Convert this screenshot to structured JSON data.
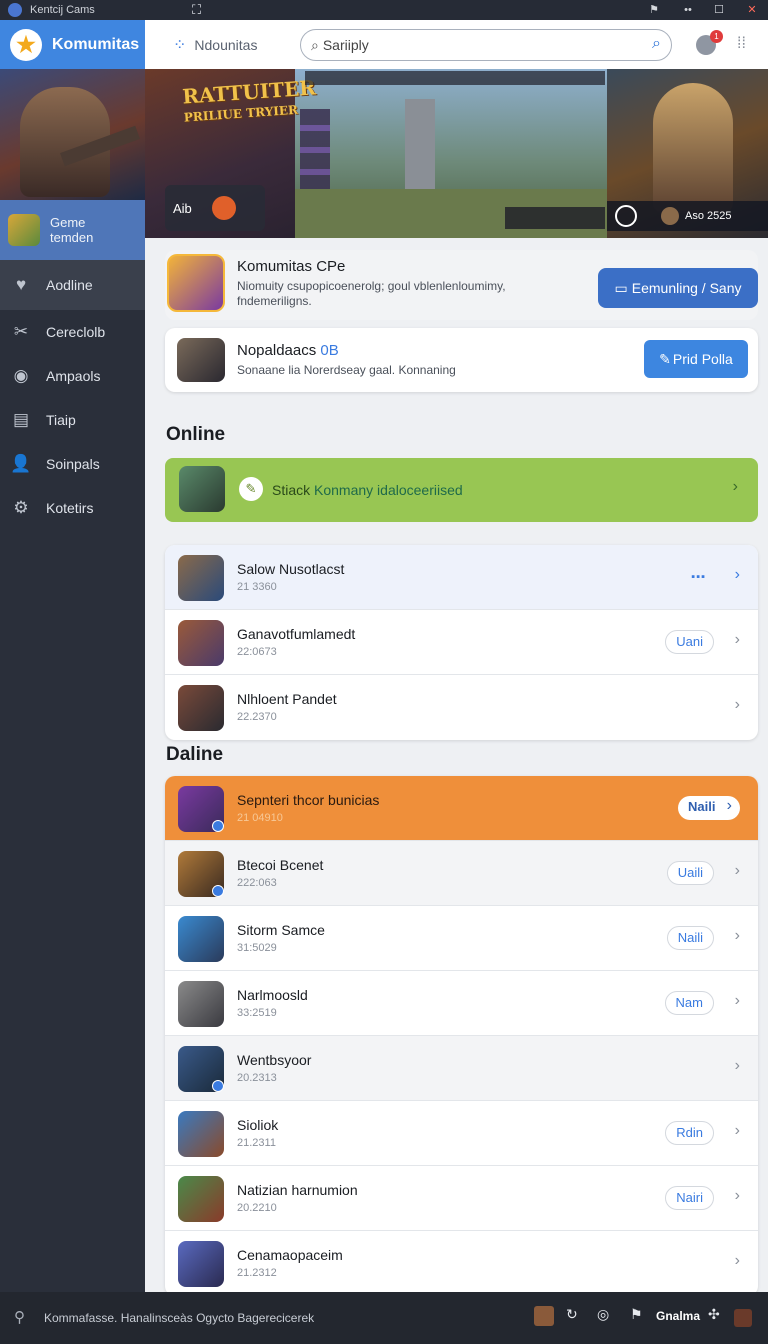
{
  "titlebar": {
    "app_name": "Kentcij Cams",
    "center_icon": "people-icon",
    "controls": [
      "share-icon",
      "more-icon",
      "maximize-icon",
      "close-icon"
    ]
  },
  "sidebar": {
    "brand": "Komumitas",
    "game_item": {
      "line1": "Geme",
      "line2": "temden"
    },
    "items": [
      {
        "label": "Aodline",
        "icon": "heart-icon",
        "active": true
      },
      {
        "label": "Cereclolb",
        "icon": "tools-icon"
      },
      {
        "label": "Ampaols",
        "icon": "target-icon"
      },
      {
        "label": "Tiaip",
        "icon": "list-icon"
      },
      {
        "label": "Soinpals",
        "icon": "person-icon"
      },
      {
        "label": "Kotetirs",
        "icon": "gear-icon"
      }
    ]
  },
  "topbar": {
    "tab_label": "Ndounitas",
    "search_value": "Sariiply",
    "notification_count": "1"
  },
  "banner": {
    "logo_line1": "RATTUITER",
    "logo_line2": "PRILIUE TRYIER",
    "panel_label": "Aib",
    "score_text": "Aso 2525"
  },
  "community": {
    "title": "Komumitas CPe",
    "description": "Niomuity csupopicoenerolg; goul vblenlenloumimy, fndemeriligns.",
    "button_label": "Eemunling / Sany"
  },
  "news": {
    "title": "Nopaldaacs",
    "tag": "0B",
    "description": "Sonaane lia Norerdseay gaal. Konnaning",
    "button_label": "Prid Polla"
  },
  "online": {
    "heading": "Online",
    "featured_text_prefix": "Stiack",
    "featured_text_highlight": "Konmany idaloceeriised",
    "rows": [
      {
        "name": "Salow Nusotlacst",
        "sub": "21 3360",
        "action": "dots",
        "tint": true
      },
      {
        "name": "Ganavotfumlamedt",
        "sub": "22:0673",
        "chip": "Uani"
      },
      {
        "name": "Nlhloent Pandet",
        "sub": "22.2370"
      }
    ]
  },
  "daline": {
    "heading": "Daline",
    "rows": [
      {
        "name": "Sepnteri thcor bunicias",
        "sub": "21 04910",
        "chip": "Naili",
        "style": "orange"
      },
      {
        "name": "Btecoi Bcenet",
        "sub": "222:063",
        "chip": "Uaili",
        "style": "gray"
      },
      {
        "name": "Sitorm Samce",
        "sub": "31:5029",
        "chip": "Naili"
      },
      {
        "name": "Narlmoosld",
        "sub": "33:2519",
        "chip": "Nam"
      },
      {
        "name": "Wentbsyoor",
        "sub": "20.2313",
        "style": "gray"
      },
      {
        "name": "Sioliok",
        "sub": "21.2311",
        "chip": "Rdin"
      },
      {
        "name": "Natizian harnumion",
        "sub": "20.2210",
        "chip": "Nairi"
      },
      {
        "name": "Cenamaopaceim",
        "sub": "21.2312"
      }
    ]
  },
  "statusbar": {
    "text": "Kommafasse. Hanalinsceàs Ogycto Bagerecicerek",
    "right_label": "Gnalma"
  },
  "colors": {
    "accent": "#3b6fc6",
    "brand": "#3f86e0",
    "featured": "#98c653",
    "highlight_row": "#ef8f3a",
    "sidebar": "#2a2f3a"
  }
}
